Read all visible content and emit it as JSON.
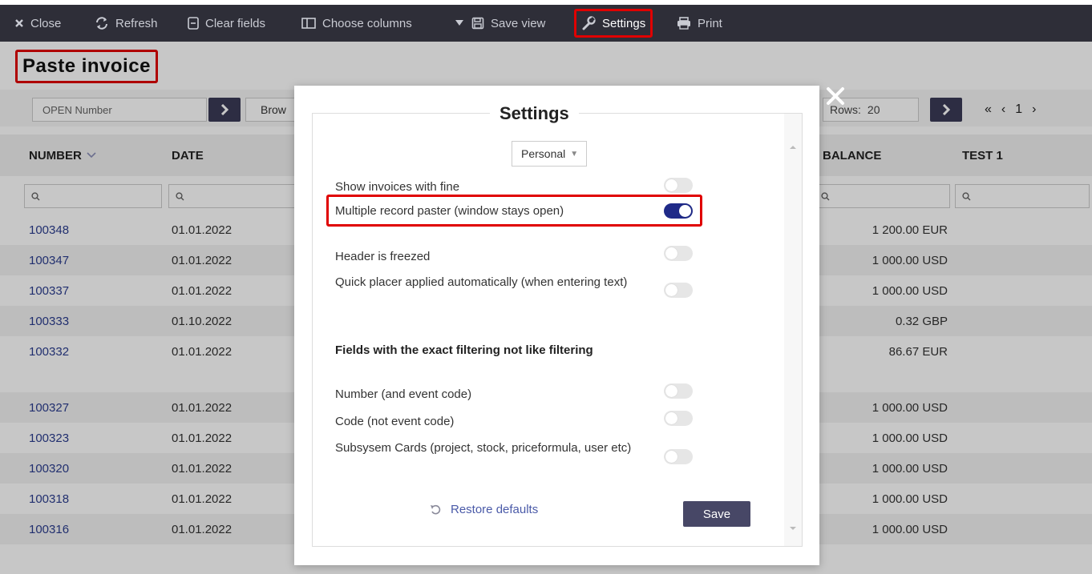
{
  "toolbar": {
    "close_label": "Close",
    "refresh_label": "Refresh",
    "clear_fields_label": "Clear fields",
    "choose_columns_label": "Choose columns",
    "save_view_label": "Save view",
    "settings_label": "Settings",
    "print_label": "Print"
  },
  "page": {
    "title": "Paste invoice",
    "open_number_placeholder": "OPEN Number",
    "browse_label": "Brow",
    "rows_label": "Rows:",
    "rows_value": "20",
    "current_page": "1"
  },
  "table": {
    "columns": [
      "NUMBER",
      "DATE",
      "BALANCE",
      "TEST 1"
    ],
    "rows": [
      {
        "number": "100348",
        "date": "01.01.2022",
        "balance": "1 200.00 EUR"
      },
      {
        "number": "100347",
        "date": "01.01.2022",
        "balance": "1 000.00 USD"
      },
      {
        "number": "100337",
        "date": "01.01.2022",
        "balance": "1 000.00 USD"
      },
      {
        "number": "100333",
        "date": "01.10.2022",
        "balance": "0.32 GBP"
      },
      {
        "number": "100332",
        "date": "01.01.2022",
        "balance": "86.67 EUR"
      },
      {
        "number": "100327",
        "date": "01.01.2022",
        "balance": "1 000.00 USD"
      },
      {
        "number": "100323",
        "date": "01.01.2022",
        "balance": "1 000.00 USD"
      },
      {
        "number": "100320",
        "date": "01.01.2022",
        "balance": "1 000.00 USD"
      },
      {
        "number": "100318",
        "date": "01.01.2022",
        "balance": "1 000.00 USD"
      },
      {
        "number": "100316",
        "date": "01.01.2022",
        "balance": "1 000.00 USD"
      }
    ]
  },
  "settings_modal": {
    "title": "Settings",
    "scope_select": "Personal",
    "settings": [
      {
        "label": "Show invoices with fine",
        "enabled": false
      },
      {
        "label": "Multiple record paster (window stays open)",
        "enabled": true
      },
      {
        "label": "Header is freezed",
        "enabled": false
      },
      {
        "label": "Quick placer applied automatically (when entering text)",
        "enabled": false
      }
    ],
    "exact_filter_heading": "Fields with the exact filtering not like filtering",
    "exact_filter_settings": [
      {
        "label": "Number (and event code)",
        "enabled": false
      },
      {
        "label": "Code (not event code)",
        "enabled": false
      },
      {
        "label": "Subsysem Cards (project, stock, priceformula, user etc)",
        "enabled": false
      }
    ],
    "restore_defaults_label": "Restore defaults",
    "save_label": "Save"
  },
  "colors": {
    "toolbar_bg": "#2e2e38",
    "highlight": "#e00000",
    "toggle_on": "#1f2a88",
    "link": "#2b3d8f",
    "save_button": "#474766"
  }
}
